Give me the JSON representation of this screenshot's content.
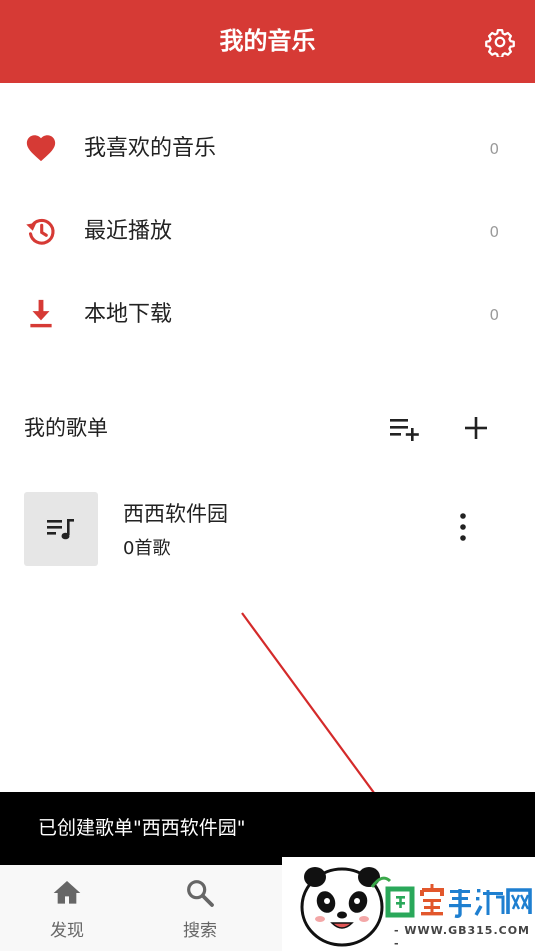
{
  "header": {
    "title": "我的音乐",
    "settings_icon": "gear-icon"
  },
  "quick_items": [
    {
      "icon": "heart-icon",
      "label": "我喜欢的音乐",
      "count": "0"
    },
    {
      "icon": "history-icon",
      "label": "最近播放",
      "count": "0"
    },
    {
      "icon": "download-icon",
      "label": "本地下载",
      "count": "0"
    }
  ],
  "playlists_section": {
    "title": "我的歌单",
    "add_to_queue_icon": "playlist-add-icon",
    "create_icon": "plus-icon"
  },
  "playlists": [
    {
      "name": "西西软件园",
      "count": "0首歌",
      "icon": "music-list-icon",
      "menu_icon": "more-vert-icon"
    }
  ],
  "toast": {
    "text": "已创建歌单\"西西软件园\""
  },
  "bottom_nav": [
    {
      "icon": "home-icon",
      "label": "发现"
    },
    {
      "icon": "search-icon",
      "label": "搜索"
    }
  ],
  "watermark": {
    "logo_text": "国宝手游网",
    "site": "- WWW.GB315.COM -"
  },
  "colors": {
    "accent": "#d63a35",
    "toast_bg": "#000000",
    "count_text": "#9a9a9a"
  }
}
